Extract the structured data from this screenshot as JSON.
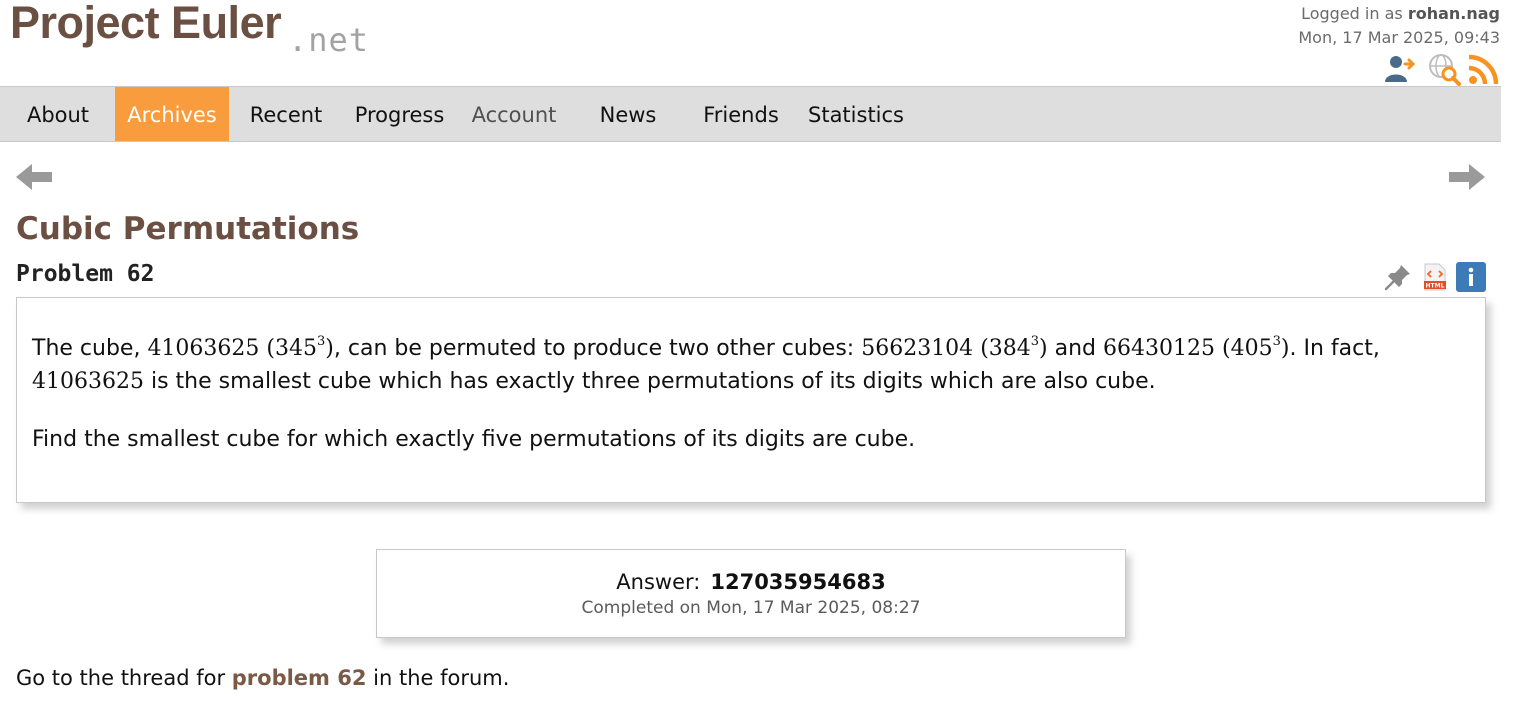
{
  "header": {
    "logo_main": "Project Euler",
    "logo_net": ".net",
    "logged_in_prefix": "Logged in as",
    "username": "rohan.nag",
    "datetime": "Mon, 17 Mar 2025, 09:43",
    "icons": [
      "account-icon",
      "search-globe-icon",
      "rss-icon"
    ]
  },
  "nav": {
    "items": [
      {
        "label": "About"
      },
      {
        "label": "Archives",
        "active": true
      },
      {
        "label": "Recent"
      },
      {
        "label": "Progress"
      },
      {
        "label": "Account"
      },
      {
        "label": "News"
      },
      {
        "label": "Friends"
      },
      {
        "label": "Statistics"
      }
    ]
  },
  "problem": {
    "title": "Cubic Permutations",
    "number_label": "Problem 62",
    "p1": {
      "t1": "The cube, ",
      "m1": "41063625",
      "m2_base": "(345",
      "m2_exp": "3",
      "m2_close": ")",
      "t2": ", can be permuted to produce two other cubes: ",
      "m3": "56623104",
      "m4_base": "(384",
      "m4_exp": "3",
      "m4_close": ")",
      "t3": " and ",
      "m5": "66430125",
      "m6_base": "(405",
      "m6_exp": "3",
      "m6_close": ")",
      "t4": ". In fact, ",
      "m7": "41063625",
      "t5": " is the smallest cube which has exactly three permutations of its digits which are also cube."
    },
    "p2": "Find the smallest cube for which exactly five permutations of its digits are cube."
  },
  "answer": {
    "label": "Answer:",
    "value": "127035954683",
    "completed": "Completed on Mon, 17 Mar 2025, 08:27"
  },
  "forum": {
    "prefix": "Go to the thread for ",
    "link_text": "problem 62",
    "suffix": " in the forum."
  },
  "colors": {
    "brand_brown": "#6b4f42",
    "nav_active": "#f89c3e",
    "nav_background": "#dedede",
    "rss": "#f7931e",
    "info_blue": "#3d7ab8"
  }
}
